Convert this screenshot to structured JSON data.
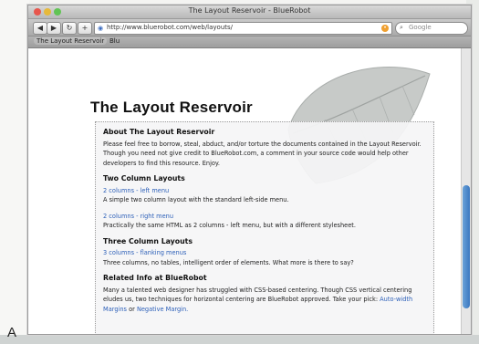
{
  "browser": {
    "window_title": "The Layout Reservoir - BlueRobot",
    "address": "http://www.bluerobot.com/web/layouts/",
    "search_placeholder": "Google",
    "bookmarks": [
      "The Layout Reservoir",
      "Blu"
    ]
  },
  "page": {
    "title": "The Layout Reservoir",
    "about": {
      "heading": "About The Layout Reservoir",
      "text_before": "Please feel free to borrow, steal, abduct, and/or torture the documents contained in the Layout Reservoir. Though you need not give credit to BlueRobot.com, a comment in your source code would help other developers to find this resource. Enjoy."
    },
    "two_col": {
      "heading": "Two Column Layouts",
      "item1_link": "2 columns - left menu",
      "item1_desc": "A simple two column layout with the standard left-side menu.",
      "item2_link": "2 columns - right menu",
      "item2_desc": "Practically the same HTML as 2 columns - left menu, but with a different stylesheet."
    },
    "three_col": {
      "heading": "Three Column Layouts",
      "item1_link": "3 columns - flanking menus",
      "item1_desc": "Three columns, no tables, intelligent order of elements. What more is there to say?"
    },
    "related": {
      "heading": "Related Info at BlueRobot",
      "text": "Many a talented web designer has struggled with CSS-based centering. Though CSS vertical centering eludes us, two techniques for horizontal centering are BlueRobot approved. Take your pick:",
      "link1": "Auto-width Margins",
      "or": "or",
      "link2": "Negative Margin."
    }
  },
  "figure_label": "A"
}
